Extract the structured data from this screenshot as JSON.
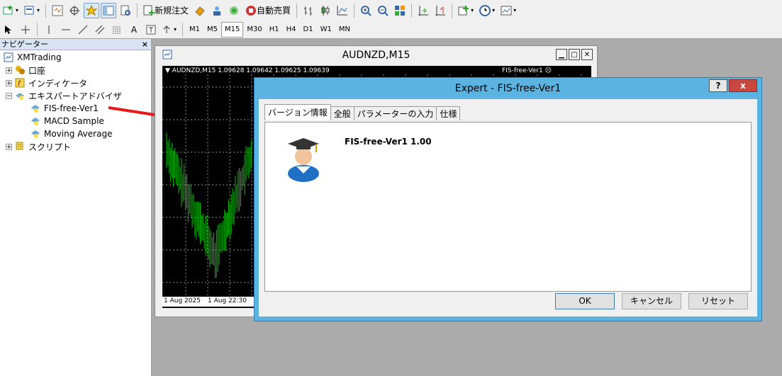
{
  "toolbar": {
    "new_order_label": "新規注文",
    "auto_trading_label": "自動売買",
    "text_tool_label": "A"
  },
  "timeframes": [
    "M1",
    "M5",
    "M15",
    "M30",
    "H1",
    "H4",
    "D1",
    "W1",
    "MN"
  ],
  "navigator": {
    "title": "ナビゲーター",
    "close": "×",
    "root": "XMTrading",
    "accounts": "口座",
    "indicators": "インディケータ",
    "experts": "エキスパートアドバイザ",
    "expert_items": [
      "FIS-free-Ver1",
      "MACD Sample",
      "Moving Average"
    ],
    "scripts": "スクリプト"
  },
  "chart_window": {
    "title": "AUDNZD,M15",
    "info": "▼ AUDNZD,M15  1.09628 1.09642 1.09625 1.09639",
    "ea_label": "FIS-free-Ver1",
    "ea_mark": "☹",
    "x_labels": [
      "1 Aug 2025",
      "1 Aug 22:30"
    ],
    "colors": {
      "background": "#000000",
      "candles": "#00c000",
      "grid": "#c0c0c0"
    }
  },
  "dialog": {
    "title": "Expert - FIS-free-Ver1",
    "help": "?",
    "close": "x",
    "tabs": [
      "バージョン情報",
      "全般",
      "パラメーターの入力",
      "仕様"
    ],
    "version_text": "FIS-free-Ver1 1.00",
    "ok_label": "OK",
    "cancel_label": "キャンセル",
    "reset_label": "リセット"
  }
}
